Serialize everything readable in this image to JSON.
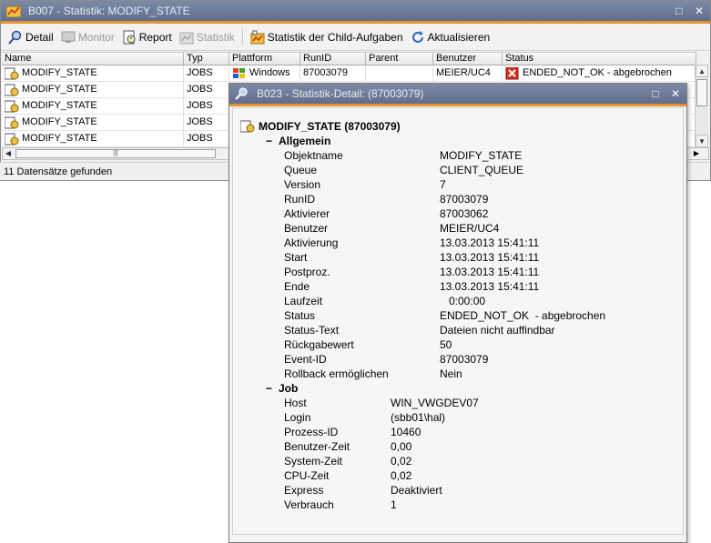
{
  "main": {
    "title": "B007 - Statistik: MODIFY_STATE",
    "toolbar": {
      "detail": "Detail",
      "monitor": "Monitor",
      "report": "Report",
      "statistik": "Statistik",
      "child_stats": "Statistik der Child-Aufgaben",
      "refresh": "Aktualisieren"
    },
    "columns": [
      "Name",
      "Typ",
      "Plattform",
      "RunID",
      "Parent",
      "Benutzer",
      "Status"
    ],
    "rows": [
      {
        "name": "MODIFY_STATE",
        "typ": "JOBS",
        "plattform": "Windows",
        "runid": "87003079",
        "parent": "",
        "benutzer": "MEIER/UC4",
        "status": "ENDED_NOT_OK  - abgebrochen"
      },
      {
        "name": "MODIFY_STATE",
        "typ": "JOBS"
      },
      {
        "name": "MODIFY_STATE",
        "typ": "JOBS"
      },
      {
        "name": "MODIFY_STATE",
        "typ": "JOBS"
      },
      {
        "name": "MODIFY_STATE",
        "typ": "JOBS"
      }
    ],
    "status_text": "11 Datensätze gefunden"
  },
  "detail": {
    "title": "B023 - Statistik-Detail: (87003079)",
    "header": "MODIFY_STATE (87003079)",
    "sections": {
      "allgemein": {
        "label": "Allgemein",
        "items": [
          {
            "k": "Objektname",
            "v": "MODIFY_STATE"
          },
          {
            "k": "Queue",
            "v": "CLIENT_QUEUE"
          },
          {
            "k": "Version",
            "v": "7"
          },
          {
            "k": "RunID",
            "v": "87003079"
          },
          {
            "k": "Aktivierer",
            "v": "87003062"
          },
          {
            "k": "Benutzer",
            "v": "MEIER/UC4"
          },
          {
            "k": "Aktivierung",
            "v": "13.03.2013 15:41:11"
          },
          {
            "k": "Start",
            "v": "13.03.2013 15:41:11"
          },
          {
            "k": "Postproz.",
            "v": "13.03.2013 15:41:11"
          },
          {
            "k": "Ende",
            "v": "13.03.2013 15:41:11"
          },
          {
            "k": "Laufzeit",
            "v": "   0:00:00"
          },
          {
            "k": "Status",
            "v": "ENDED_NOT_OK  - abgebrochen"
          },
          {
            "k": "Status-Text",
            "v": "Dateien nicht auffindbar"
          },
          {
            "k": "Rückgabewert",
            "v": "50"
          },
          {
            "k": "Event-ID",
            "v": "87003079"
          },
          {
            "k": "Rollback ermöglichen",
            "v": "Nein"
          }
        ]
      },
      "job": {
        "label": "Job",
        "items": [
          {
            "k": "Host",
            "v": "WIN_VWGDEV07"
          },
          {
            "k": "Login",
            "v": "(sbb01\\hal)"
          },
          {
            "k": "Prozess-ID",
            "v": "10460"
          },
          {
            "k": "Benutzer-Zeit",
            "v": "0,00"
          },
          {
            "k": "System-Zeit",
            "v": "0,02"
          },
          {
            "k": "CPU-Zeit",
            "v": "0,02"
          },
          {
            "k": "Express",
            "v": "Deaktiviert"
          },
          {
            "k": "Verbrauch",
            "v": "1"
          }
        ]
      }
    }
  }
}
